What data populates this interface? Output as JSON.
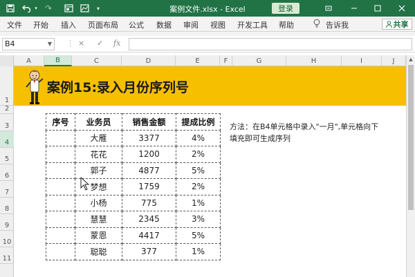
{
  "window": {
    "title": "案例文件.xlsx  -  Excel",
    "login_label": "登录",
    "window_controls": [
      "restore-down-icon",
      "minimize-icon",
      "maximize-icon",
      "close-icon"
    ],
    "accent_color": "#217346"
  },
  "quick_access": {
    "icons": [
      "save-icon",
      "undo-icon",
      "undo-dropdown-icon",
      "form-icon",
      "chart-icon",
      "customize-icon"
    ]
  },
  "ribbon": {
    "tabs": [
      "文件",
      "开始",
      "插入",
      "页面布局",
      "公式",
      "数据",
      "审阅",
      "视图",
      "开发工具",
      "帮助"
    ],
    "tell_me": "告诉我",
    "share_label": "共享"
  },
  "formula_bar": {
    "name_box": "B4",
    "cancel_glyph": "×",
    "enter_glyph": "✓",
    "fx_label": "fx",
    "formula": ""
  },
  "columns": [
    "A",
    "B",
    "C",
    "D",
    "E",
    "F",
    "G",
    "H",
    "I",
    "J"
  ],
  "active_column": "B",
  "rows": [
    "1",
    "2",
    "3",
    "4",
    "5",
    "6",
    "7",
    "8",
    "9",
    "10",
    "11"
  ],
  "active_row": "4",
  "banner": {
    "title": "案例15:录入月份序列号",
    "background": "#f6c000"
  },
  "table": {
    "headers": [
      "序号",
      "业务员",
      "销售金额",
      "提成比例"
    ],
    "rows": [
      [
        "",
        "大雁",
        "3377",
        "4%"
      ],
      [
        "",
        "花花",
        "1200",
        "2%"
      ],
      [
        "",
        "郭子",
        "4877",
        "5%"
      ],
      [
        "",
        "梦想",
        "1759",
        "2%"
      ],
      [
        "",
        "小杨",
        "775",
        "1%"
      ],
      [
        "",
        "慧慧",
        "2345",
        "3%"
      ],
      [
        "",
        "蒙恩",
        "4417",
        "5%"
      ],
      [
        "",
        "聪聪",
        "377",
        "1%"
      ]
    ]
  },
  "note": {
    "line1": "方法：在B4单元格中录入\"一月\",单元格向下",
    "line2": "填充即可生成序列"
  }
}
